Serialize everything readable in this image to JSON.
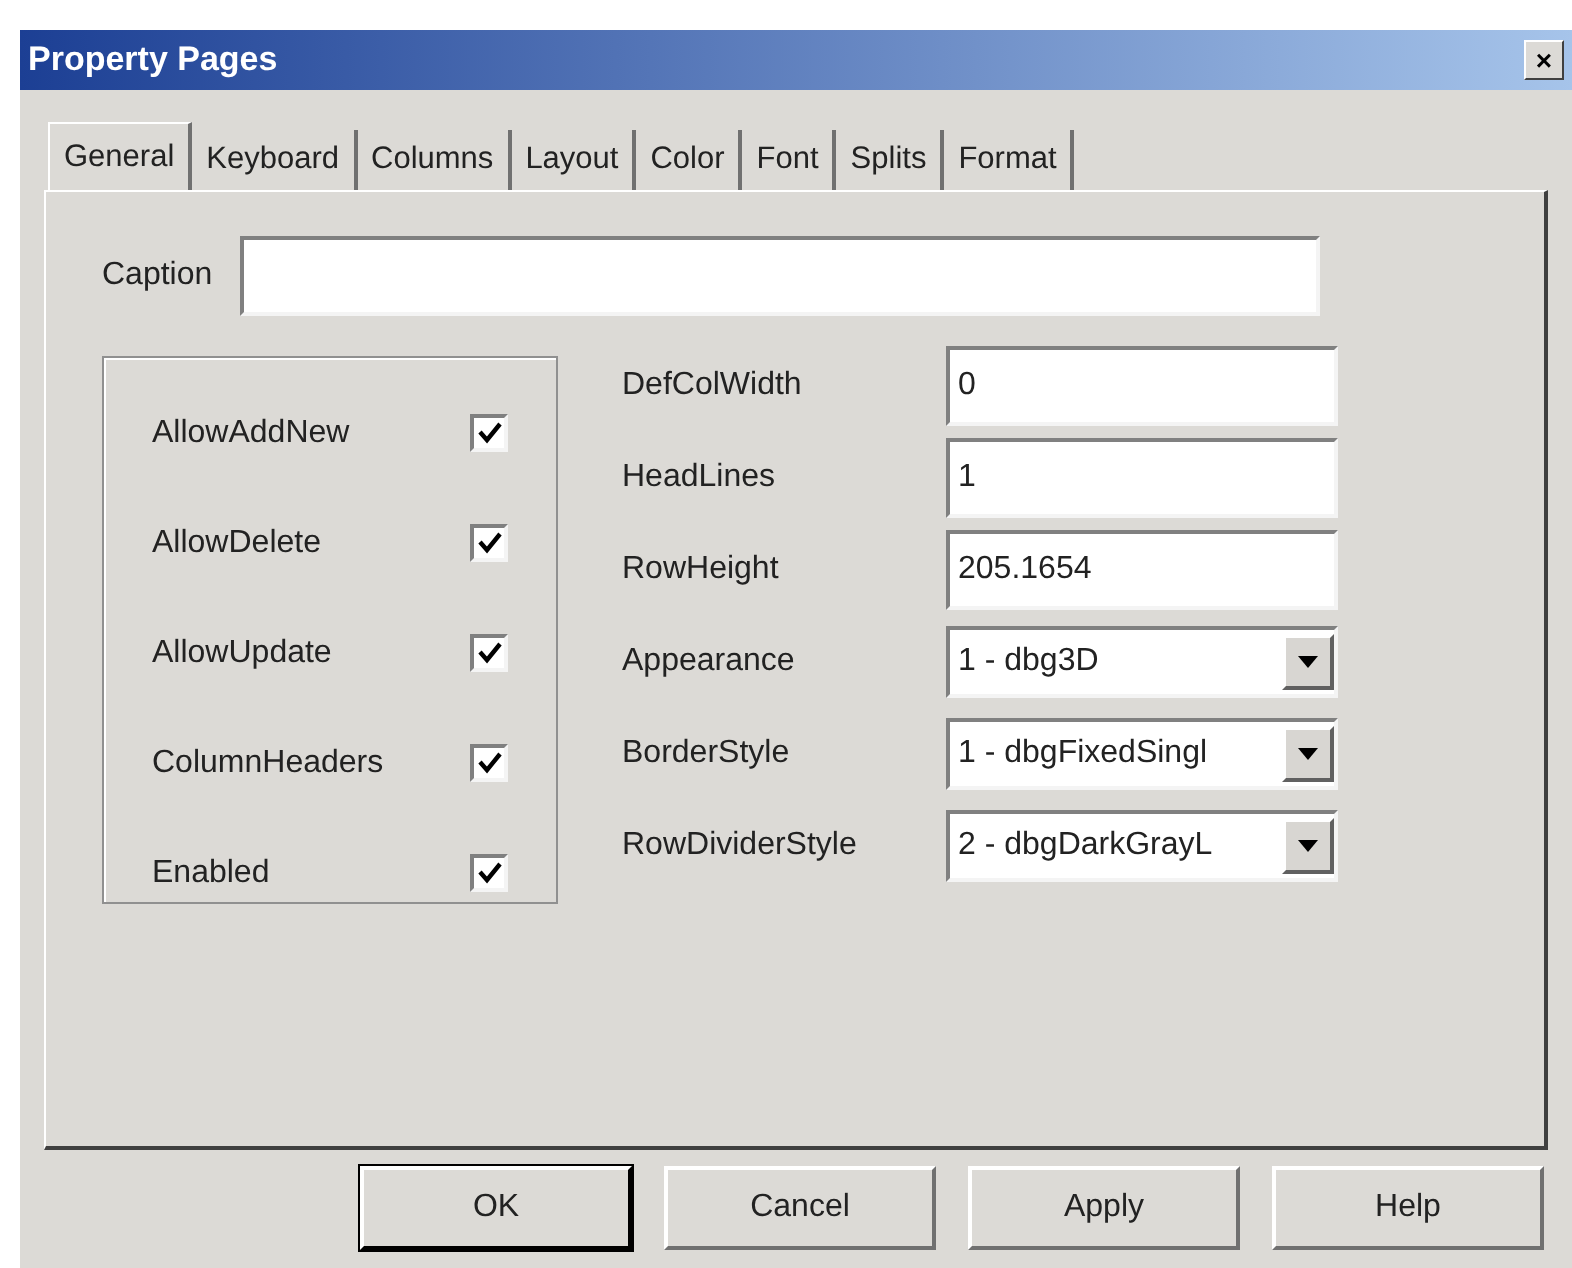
{
  "window": {
    "title": "Property Pages",
    "close": "×"
  },
  "tabs": [
    {
      "label": "General",
      "selected": true
    },
    {
      "label": "Keyboard",
      "selected": false
    },
    {
      "label": "Columns",
      "selected": false
    },
    {
      "label": "Layout",
      "selected": false
    },
    {
      "label": "Color",
      "selected": false
    },
    {
      "label": "Font",
      "selected": false
    },
    {
      "label": "Splits",
      "selected": false
    },
    {
      "label": "Format",
      "selected": false
    }
  ],
  "caption": {
    "label": "Caption"
  },
  "checkboxes": [
    {
      "label": "AllowAddNew",
      "checked": true
    },
    {
      "label": "AllowDelete",
      "checked": true
    },
    {
      "label": "AllowUpdate",
      "checked": true
    },
    {
      "label": "ColumnHeaders",
      "checked": true
    },
    {
      "label": "Enabled",
      "checked": true
    }
  ],
  "properties": [
    {
      "kind": "text",
      "label": "DefColWidth",
      "value": "0"
    },
    {
      "kind": "text",
      "label": "HeadLines",
      "value": "1"
    },
    {
      "kind": "text",
      "label": "RowHeight",
      "value": "205.1654"
    },
    {
      "kind": "dropdown",
      "label": "Appearance",
      "value": "1 - dbg3D"
    },
    {
      "kind": "dropdown",
      "label": "BorderStyle",
      "value": "1 - dbgFixedSingl"
    },
    {
      "kind": "dropdown",
      "label": "RowDividerStyle",
      "value": "2 - dbgDarkGrayL"
    }
  ],
  "buttons": [
    {
      "label": "OK",
      "default": true
    },
    {
      "label": "Cancel",
      "default": false
    },
    {
      "label": "Apply",
      "default": false
    },
    {
      "label": "Help",
      "default": false
    }
  ]
}
